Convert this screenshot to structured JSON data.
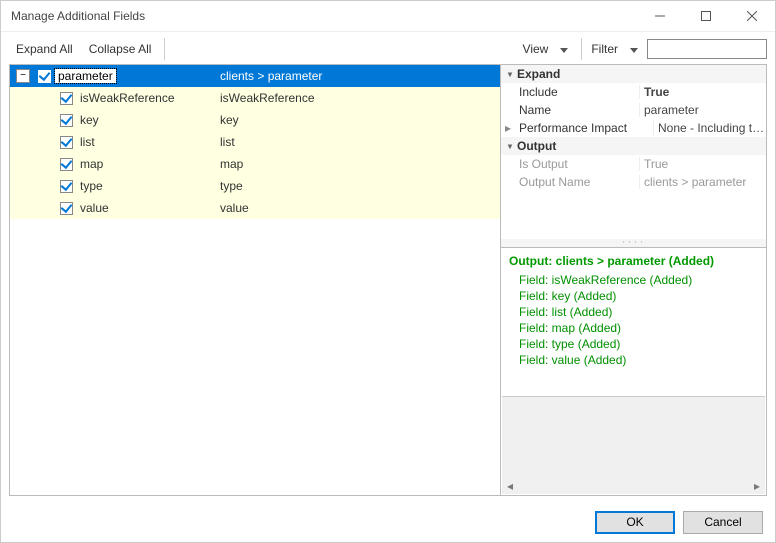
{
  "window": {
    "title": "Manage Additional Fields"
  },
  "toolbar": {
    "expand_all": "Expand All",
    "collapse_all": "Collapse All",
    "view_label": "View",
    "filter_label": "Filter",
    "filter_value": ""
  },
  "tree": {
    "root": {
      "name": "parameter",
      "path": "clients > parameter",
      "expanded": true,
      "checked": true
    },
    "children": [
      {
        "name": "isWeakReference",
        "path": "isWeakReference",
        "checked": true
      },
      {
        "name": "key",
        "path": "key",
        "checked": true
      },
      {
        "name": "list",
        "path": "list",
        "checked": true
      },
      {
        "name": "map",
        "path": "map",
        "checked": true
      },
      {
        "name": "type",
        "path": "type",
        "checked": true
      },
      {
        "name": "value",
        "path": "value",
        "checked": true
      }
    ]
  },
  "props": {
    "expand_cat": "Expand",
    "include_label": "Include",
    "include_value": "True",
    "name_label": "Name",
    "name_value": "parameter",
    "perf_label": "Performance Impact",
    "perf_value": "None - Including this item will",
    "output_cat": "Output",
    "isoutput_label": "Is Output",
    "isoutput_value": "True",
    "outname_label": "Output Name",
    "outname_value": "clients > parameter"
  },
  "log": {
    "heading": "Output: clients > parameter (Added)",
    "items": [
      "Field: isWeakReference (Added)",
      "Field: key (Added)",
      "Field: list (Added)",
      "Field: map (Added)",
      "Field: type (Added)",
      "Field: value (Added)"
    ]
  },
  "footer": {
    "ok": "OK",
    "cancel": "Cancel"
  }
}
